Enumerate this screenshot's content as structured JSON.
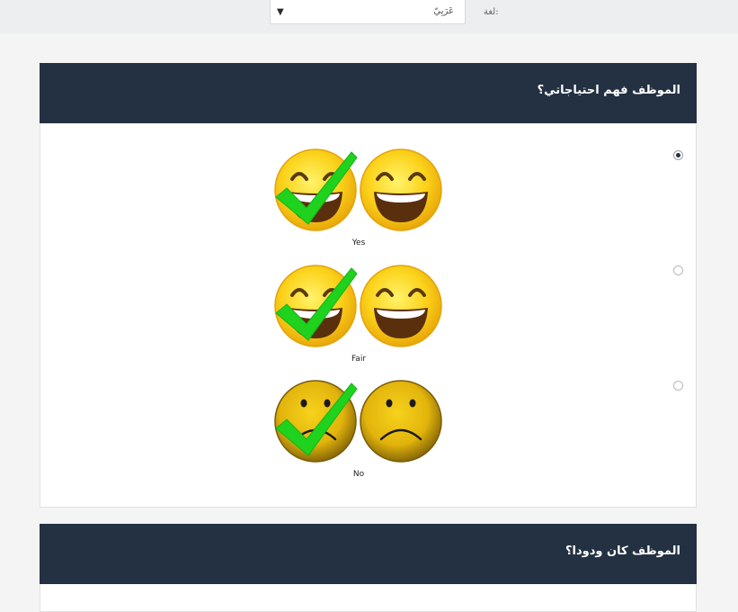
{
  "language": {
    "label": "لغة:",
    "selected": "عَرَبِيّ",
    "arrow_icon": "triangle-down-icon"
  },
  "questions": [
    {
      "title": "الموظف فهم احتياجاتي؟",
      "options": [
        {
          "caption": "Yes",
          "selected": true,
          "face": "happy"
        },
        {
          "caption": "Fair",
          "selected": false,
          "face": "happy"
        },
        {
          "caption": "No",
          "selected": false,
          "face": "sad"
        }
      ]
    },
    {
      "title": "الموظف كان ودودا؟"
    }
  ],
  "colors": {
    "header_bg": "#233142",
    "page_bg": "#f4f4f4",
    "checkmark": "#1ed21e",
    "face_yellow": "#fbd21a"
  }
}
